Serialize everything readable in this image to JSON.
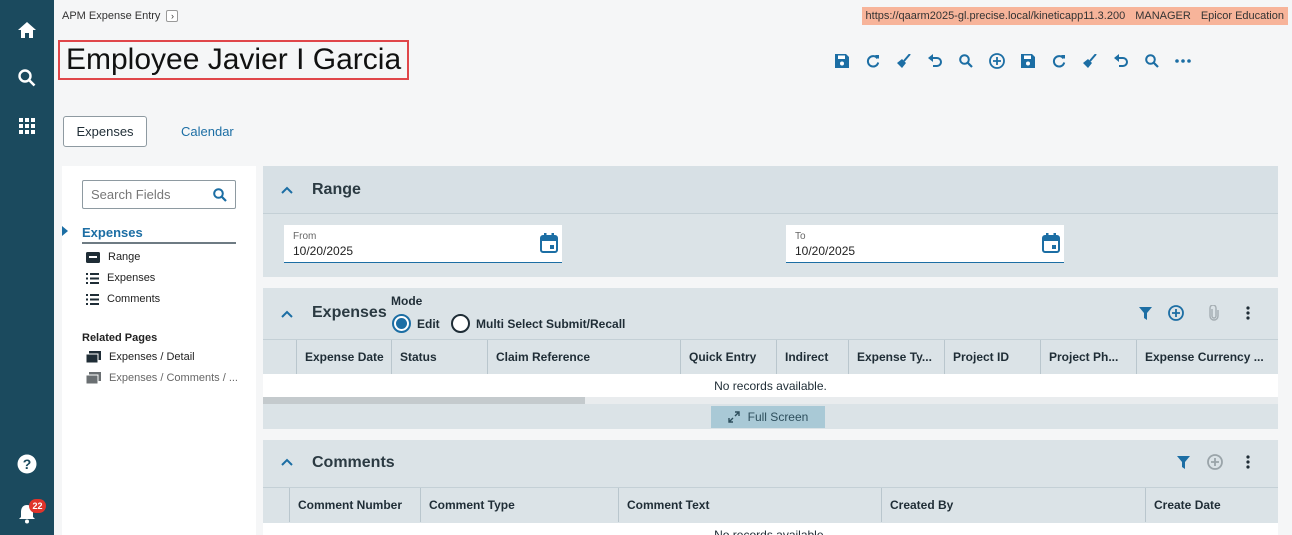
{
  "app": {
    "breadcrumb": "APM Expense Entry",
    "env_url": "https://qaarm2025-gl.precise.local/kineticapp11.3.200",
    "env_user": "MANAGER",
    "env_company": "Epicor Education",
    "notification_count": "22"
  },
  "page": {
    "title": "Employee Javier I Garcia"
  },
  "tabs": {
    "expenses": "Expenses",
    "calendar": "Calendar"
  },
  "sidebar": {
    "search_placeholder": "Search Fields",
    "selected": "Expenses",
    "items": [
      "Range",
      "Expenses",
      "Comments"
    ],
    "related_header": "Related Pages",
    "related": [
      "Expenses / Detail",
      "Expenses / Comments / ..."
    ]
  },
  "range": {
    "title": "Range",
    "from_label": "From",
    "from_value": "10/20/2025",
    "to_label": "To",
    "to_value": "10/20/2025"
  },
  "expenses": {
    "title": "Expenses",
    "mode_label": "Mode",
    "mode_edit": "Edit",
    "mode_multi": "Multi Select Submit/Recall",
    "columns": [
      "Expense Date",
      "Status",
      "Claim Reference",
      "Quick Entry",
      "Indirect",
      "Expense Ty...",
      "Project ID",
      "Project Ph...",
      "Expense Currency ..."
    ],
    "empty": "No records available.",
    "fullscreen": "Full Screen"
  },
  "comments": {
    "title": "Comments",
    "columns": [
      "Comment Number",
      "Comment Type",
      "Comment Text",
      "Created By",
      "Create Date"
    ],
    "empty": "No records available."
  },
  "colors": {
    "rail": "#1b4a5e",
    "accent": "#1c6ea4",
    "env_badge": "#f7b49a",
    "title_outline": "#e0464a"
  }
}
